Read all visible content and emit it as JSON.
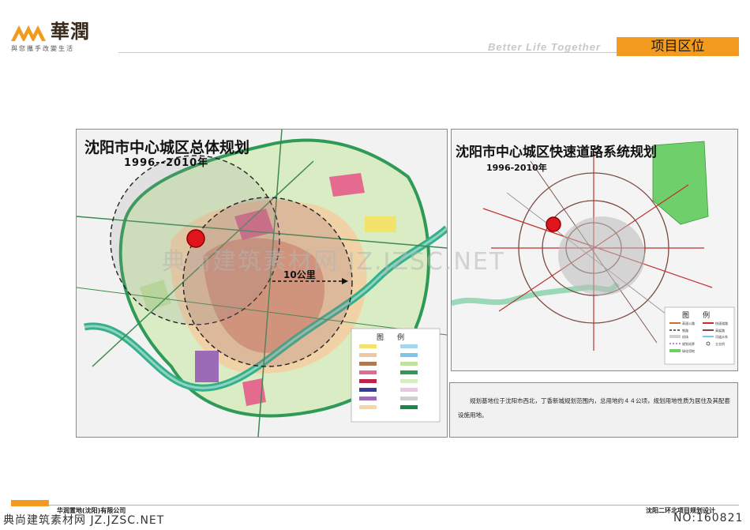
{
  "header": {
    "logo_name": "華潤",
    "logo_slogan": "與您攜手改變生活",
    "tagline": "Better Life Together",
    "section_title": "项目区位",
    "accent_color": "#f39b1f"
  },
  "map_left": {
    "title": "沈阳市中心城区总体规划",
    "years": "1996--2010年",
    "distance_label": "10公里",
    "legend_title": "图      例",
    "marker_color": "#e0141c"
  },
  "map_right": {
    "title": "沈阳市中心城区快速道路系统规划",
    "years": "1996-2010年",
    "legend_title": "图      例",
    "legend_items": [
      "高速公路",
      "快速道路",
      "铁路",
      "高架路",
      "机场",
      "河道水系",
      "规划站界",
      "立交桥",
      "绿化用地"
    ],
    "marker_color": "#e0141c"
  },
  "description": "规划基地位于沈阳市西北，丁香新城规划范围内，总用地约４４公顷，规划用地性质为居住及其配套设施用地。",
  "footer": {
    "company": "华润置地(沈阳)有限公司",
    "project": "沈阳二环北项目规划设计"
  },
  "watermarks": {
    "center": "典尚建筑素材网 JZ.JZSC.NET",
    "bottom_left": "典尚建筑素材网 JZ.JZSC.NET",
    "bottom_right": "NO:160821"
  }
}
